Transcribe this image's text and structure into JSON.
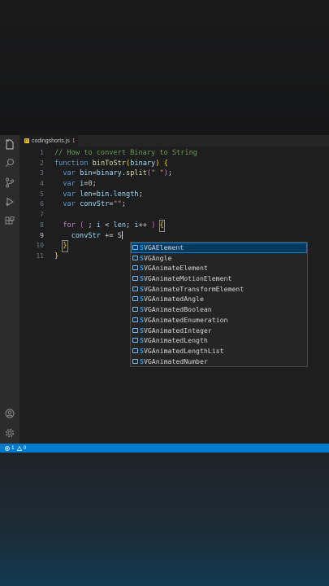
{
  "tab": {
    "badge": "JS",
    "filename": "codingshorts.js",
    "count": "1"
  },
  "activity_icons": [
    "files-icon",
    "search-icon",
    "source-control-icon",
    "run-debug-icon",
    "extensions-icon",
    "account-icon",
    "gear-icon"
  ],
  "line_numbers": [
    "1",
    "2",
    "3",
    "4",
    "5",
    "6",
    "7",
    "8",
    "9",
    "10",
    "11"
  ],
  "code": {
    "l1": "// How to convert Binary to String",
    "l2_kw": "function",
    "l2_fn": "binToStr",
    "l2_param": "binary",
    "l3_kw": "var",
    "l3_var": "bin",
    "l3_obj": "binary",
    "l3_method": "split",
    "l3_str": "\" \"",
    "l4_kw": "var",
    "l4_var": "i",
    "l4_num": "0",
    "l5_kw": "var",
    "l5_var": "len",
    "l5_obj": "bin",
    "l5_prop": "length",
    "l6_kw": "var",
    "l6_var": "convStr",
    "l6_str": "\"\"",
    "l8_kw": "for",
    "l8_var_i": "i",
    "l8_var_len": "len",
    "l8_var_i2": "i",
    "l9_var": "convStr",
    "l9_typed": "S"
  },
  "suggestions": [
    "SVGAElement",
    "SVGAngle",
    "SVGAnimateElement",
    "SVGAnimateMotionElement",
    "SVGAnimateTransformElement",
    "SVGAnimatedAngle",
    "SVGAnimatedBoolean",
    "SVGAnimatedEnumeration",
    "SVGAnimatedInteger",
    "SVGAnimatedLength",
    "SVGAnimatedLengthList",
    "SVGAnimatedNumber"
  ],
  "suggestion_match": "S",
  "status": {
    "errors": "1",
    "warnings": "0"
  },
  "colors": {
    "status_bar": "#007acc",
    "selected_suggestion": "#04395e",
    "js_badge": "#e8c43a"
  }
}
